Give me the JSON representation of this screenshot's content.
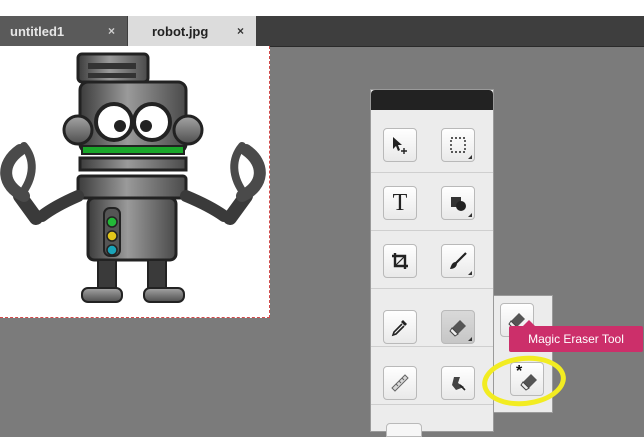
{
  "tabs": [
    {
      "label": "untitled1",
      "close": "×"
    },
    {
      "label": "robot.jpg",
      "close": "×"
    }
  ],
  "image": {
    "description_icon": "robot-image"
  },
  "tools": [
    {
      "name": "move-tool",
      "icon": "cursor-move-icon"
    },
    {
      "name": "marquee-tool",
      "icon": "marquee-icon"
    },
    {
      "name": "text-tool",
      "icon": "text-icon",
      "label": "T"
    },
    {
      "name": "shape-tool",
      "icon": "shape-icon"
    },
    {
      "name": "crop-tool",
      "icon": "crop-icon"
    },
    {
      "name": "brush-tool",
      "icon": "brush-icon"
    },
    {
      "name": "eyedropper-tool",
      "icon": "eyedropper-icon"
    },
    {
      "name": "eraser-tool",
      "icon": "eraser-icon"
    },
    {
      "name": "ruler-tool",
      "icon": "ruler-icon"
    },
    {
      "name": "stamp-tool",
      "icon": "stamp-icon"
    }
  ],
  "flyout": {
    "tooltip": "Magic Eraser Tool",
    "items": [
      {
        "name": "eraser-tool",
        "icon": "eraser-icon"
      },
      {
        "name": "magic-eraser-tool",
        "icon": "magic-eraser-icon",
        "symbol": "*"
      }
    ]
  },
  "colors": {
    "workspace": "#7b7b7b",
    "tooltip": "#cc2f6a",
    "highlight": "#f2ec21",
    "canvas_border": "#d24a4a"
  }
}
